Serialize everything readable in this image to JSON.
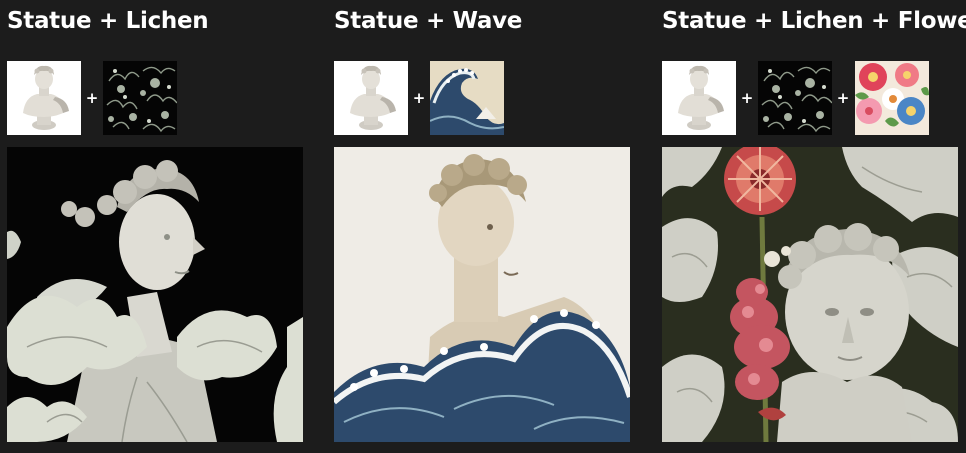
{
  "panels": [
    {
      "title": "Statue + Lichen",
      "inputs": [
        "statue",
        "lichen"
      ],
      "plus": [
        "+"
      ]
    },
    {
      "title": "Statue + Wave",
      "inputs": [
        "statue",
        "wave"
      ],
      "plus": [
        "+"
      ]
    },
    {
      "title": "Statue + Lichen + Flowers",
      "inputs": [
        "statue",
        "lichen",
        "flowers"
      ],
      "plus": [
        "+",
        "+"
      ]
    }
  ],
  "colors": {
    "page_background": "#1c1c1c",
    "title_text": "#ffffff",
    "lichen_background": "#050505",
    "wave_background": "#efece6",
    "wave_blue": "#2d4a6c",
    "flowers_background": "#2a2e1f",
    "flower_red": "#c64a4a"
  }
}
